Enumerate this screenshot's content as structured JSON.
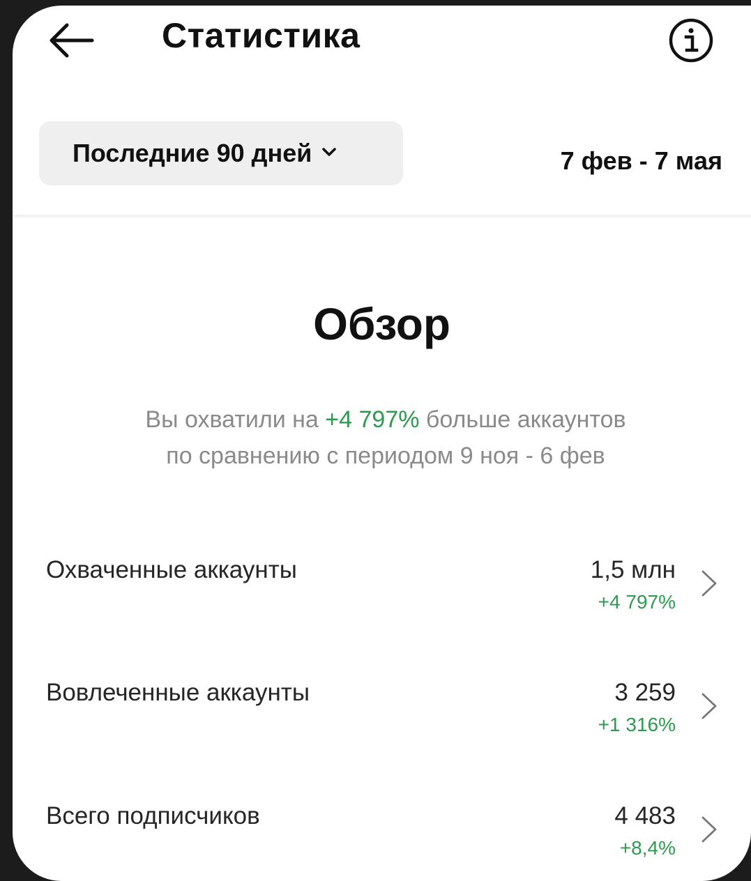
{
  "header": {
    "back_icon": "arrow-left-icon",
    "title": "Статистика",
    "info_icon": "info-circle-icon"
  },
  "filter": {
    "period_label": "Последние 90 дней",
    "dropdown_icon": "chevron-down-icon",
    "date_range": "7 фев - 7 мая"
  },
  "overview": {
    "title": "Обзор",
    "desc_prefix": "Вы охватили на ",
    "desc_highlight": "+4 797%",
    "desc_suffix_line1": " больше аккаунтов",
    "desc_line2": "по сравнению с периодом 9 ноя - 6 фев"
  },
  "metrics": [
    {
      "label": "Охваченные аккаунты",
      "value": "1,5 млн",
      "change": "+4 797%"
    },
    {
      "label": "Вовлеченные аккаунты",
      "value": "3 259",
      "change": "+1 316%"
    },
    {
      "label": "Всего подписчиков",
      "value": "4 483",
      "change": "+8,4%"
    }
  ],
  "colors": {
    "accent_green": "#2e9a4f",
    "muted_text": "#8a8a8a",
    "select_bg": "#efefef"
  }
}
